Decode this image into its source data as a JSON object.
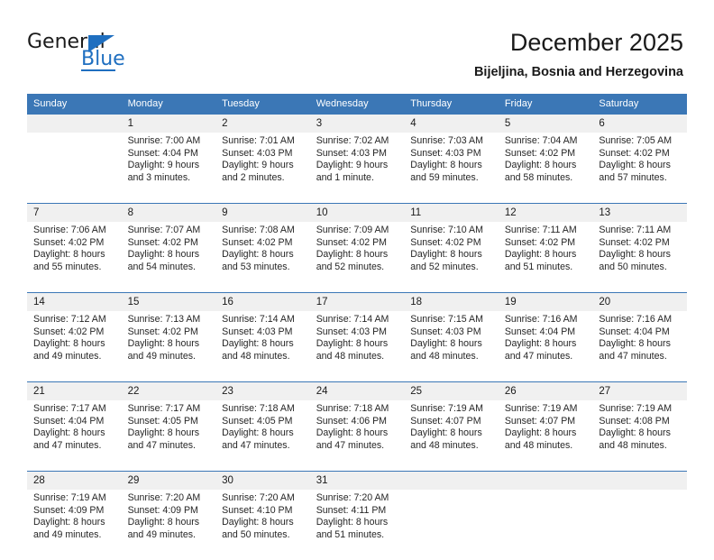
{
  "brand": {
    "name_part1": "General",
    "name_part2": "Blue",
    "triangle_icon": "triangle-icon",
    "accent_color": "#1f6fc0"
  },
  "header": {
    "title": "December 2025",
    "subtitle": "Bijeljina, Bosnia and Herzegovina"
  },
  "theme": {
    "header_row_color": "#3b77b6",
    "day_number_row_color": "#f0f0f0",
    "separator_color": "#3b77b6",
    "text_color": "#1a1a1a"
  },
  "calendar": {
    "weekdays": [
      "Sunday",
      "Monday",
      "Tuesday",
      "Wednesday",
      "Thursday",
      "Friday",
      "Saturday"
    ],
    "weeks": [
      [
        {
          "day": "",
          "sunrise": "",
          "sunset": "",
          "daylight_line1": "",
          "daylight_line2": ""
        },
        {
          "day": "1",
          "sunrise": "Sunrise: 7:00 AM",
          "sunset": "Sunset: 4:04 PM",
          "daylight_line1": "Daylight: 9 hours",
          "daylight_line2": "and 3 minutes."
        },
        {
          "day": "2",
          "sunrise": "Sunrise: 7:01 AM",
          "sunset": "Sunset: 4:03 PM",
          "daylight_line1": "Daylight: 9 hours",
          "daylight_line2": "and 2 minutes."
        },
        {
          "day": "3",
          "sunrise": "Sunrise: 7:02 AM",
          "sunset": "Sunset: 4:03 PM",
          "daylight_line1": "Daylight: 9 hours",
          "daylight_line2": "and 1 minute."
        },
        {
          "day": "4",
          "sunrise": "Sunrise: 7:03 AM",
          "sunset": "Sunset: 4:03 PM",
          "daylight_line1": "Daylight: 8 hours",
          "daylight_line2": "and 59 minutes."
        },
        {
          "day": "5",
          "sunrise": "Sunrise: 7:04 AM",
          "sunset": "Sunset: 4:02 PM",
          "daylight_line1": "Daylight: 8 hours",
          "daylight_line2": "and 58 minutes."
        },
        {
          "day": "6",
          "sunrise": "Sunrise: 7:05 AM",
          "sunset": "Sunset: 4:02 PM",
          "daylight_line1": "Daylight: 8 hours",
          "daylight_line2": "and 57 minutes."
        }
      ],
      [
        {
          "day": "7",
          "sunrise": "Sunrise: 7:06 AM",
          "sunset": "Sunset: 4:02 PM",
          "daylight_line1": "Daylight: 8 hours",
          "daylight_line2": "and 55 minutes."
        },
        {
          "day": "8",
          "sunrise": "Sunrise: 7:07 AM",
          "sunset": "Sunset: 4:02 PM",
          "daylight_line1": "Daylight: 8 hours",
          "daylight_line2": "and 54 minutes."
        },
        {
          "day": "9",
          "sunrise": "Sunrise: 7:08 AM",
          "sunset": "Sunset: 4:02 PM",
          "daylight_line1": "Daylight: 8 hours",
          "daylight_line2": "and 53 minutes."
        },
        {
          "day": "10",
          "sunrise": "Sunrise: 7:09 AM",
          "sunset": "Sunset: 4:02 PM",
          "daylight_line1": "Daylight: 8 hours",
          "daylight_line2": "and 52 minutes."
        },
        {
          "day": "11",
          "sunrise": "Sunrise: 7:10 AM",
          "sunset": "Sunset: 4:02 PM",
          "daylight_line1": "Daylight: 8 hours",
          "daylight_line2": "and 52 minutes."
        },
        {
          "day": "12",
          "sunrise": "Sunrise: 7:11 AM",
          "sunset": "Sunset: 4:02 PM",
          "daylight_line1": "Daylight: 8 hours",
          "daylight_line2": "and 51 minutes."
        },
        {
          "day": "13",
          "sunrise": "Sunrise: 7:11 AM",
          "sunset": "Sunset: 4:02 PM",
          "daylight_line1": "Daylight: 8 hours",
          "daylight_line2": "and 50 minutes."
        }
      ],
      [
        {
          "day": "14",
          "sunrise": "Sunrise: 7:12 AM",
          "sunset": "Sunset: 4:02 PM",
          "daylight_line1": "Daylight: 8 hours",
          "daylight_line2": "and 49 minutes."
        },
        {
          "day": "15",
          "sunrise": "Sunrise: 7:13 AM",
          "sunset": "Sunset: 4:02 PM",
          "daylight_line1": "Daylight: 8 hours",
          "daylight_line2": "and 49 minutes."
        },
        {
          "day": "16",
          "sunrise": "Sunrise: 7:14 AM",
          "sunset": "Sunset: 4:03 PM",
          "daylight_line1": "Daylight: 8 hours",
          "daylight_line2": "and 48 minutes."
        },
        {
          "day": "17",
          "sunrise": "Sunrise: 7:14 AM",
          "sunset": "Sunset: 4:03 PM",
          "daylight_line1": "Daylight: 8 hours",
          "daylight_line2": "and 48 minutes."
        },
        {
          "day": "18",
          "sunrise": "Sunrise: 7:15 AM",
          "sunset": "Sunset: 4:03 PM",
          "daylight_line1": "Daylight: 8 hours",
          "daylight_line2": "and 48 minutes."
        },
        {
          "day": "19",
          "sunrise": "Sunrise: 7:16 AM",
          "sunset": "Sunset: 4:04 PM",
          "daylight_line1": "Daylight: 8 hours",
          "daylight_line2": "and 47 minutes."
        },
        {
          "day": "20",
          "sunrise": "Sunrise: 7:16 AM",
          "sunset": "Sunset: 4:04 PM",
          "daylight_line1": "Daylight: 8 hours",
          "daylight_line2": "and 47 minutes."
        }
      ],
      [
        {
          "day": "21",
          "sunrise": "Sunrise: 7:17 AM",
          "sunset": "Sunset: 4:04 PM",
          "daylight_line1": "Daylight: 8 hours",
          "daylight_line2": "and 47 minutes."
        },
        {
          "day": "22",
          "sunrise": "Sunrise: 7:17 AM",
          "sunset": "Sunset: 4:05 PM",
          "daylight_line1": "Daylight: 8 hours",
          "daylight_line2": "and 47 minutes."
        },
        {
          "day": "23",
          "sunrise": "Sunrise: 7:18 AM",
          "sunset": "Sunset: 4:05 PM",
          "daylight_line1": "Daylight: 8 hours",
          "daylight_line2": "and 47 minutes."
        },
        {
          "day": "24",
          "sunrise": "Sunrise: 7:18 AM",
          "sunset": "Sunset: 4:06 PM",
          "daylight_line1": "Daylight: 8 hours",
          "daylight_line2": "and 47 minutes."
        },
        {
          "day": "25",
          "sunrise": "Sunrise: 7:19 AM",
          "sunset": "Sunset: 4:07 PM",
          "daylight_line1": "Daylight: 8 hours",
          "daylight_line2": "and 48 minutes."
        },
        {
          "day": "26",
          "sunrise": "Sunrise: 7:19 AM",
          "sunset": "Sunset: 4:07 PM",
          "daylight_line1": "Daylight: 8 hours",
          "daylight_line2": "and 48 minutes."
        },
        {
          "day": "27",
          "sunrise": "Sunrise: 7:19 AM",
          "sunset": "Sunset: 4:08 PM",
          "daylight_line1": "Daylight: 8 hours",
          "daylight_line2": "and 48 minutes."
        }
      ],
      [
        {
          "day": "28",
          "sunrise": "Sunrise: 7:19 AM",
          "sunset": "Sunset: 4:09 PM",
          "daylight_line1": "Daylight: 8 hours",
          "daylight_line2": "and 49 minutes."
        },
        {
          "day": "29",
          "sunrise": "Sunrise: 7:20 AM",
          "sunset": "Sunset: 4:09 PM",
          "daylight_line1": "Daylight: 8 hours",
          "daylight_line2": "and 49 minutes."
        },
        {
          "day": "30",
          "sunrise": "Sunrise: 7:20 AM",
          "sunset": "Sunset: 4:10 PM",
          "daylight_line1": "Daylight: 8 hours",
          "daylight_line2": "and 50 minutes."
        },
        {
          "day": "31",
          "sunrise": "Sunrise: 7:20 AM",
          "sunset": "Sunset: 4:11 PM",
          "daylight_line1": "Daylight: 8 hours",
          "daylight_line2": "and 51 minutes."
        },
        {
          "day": "",
          "sunrise": "",
          "sunset": "",
          "daylight_line1": "",
          "daylight_line2": ""
        },
        {
          "day": "",
          "sunrise": "",
          "sunset": "",
          "daylight_line1": "",
          "daylight_line2": ""
        },
        {
          "day": "",
          "sunrise": "",
          "sunset": "",
          "daylight_line1": "",
          "daylight_line2": ""
        }
      ]
    ]
  }
}
